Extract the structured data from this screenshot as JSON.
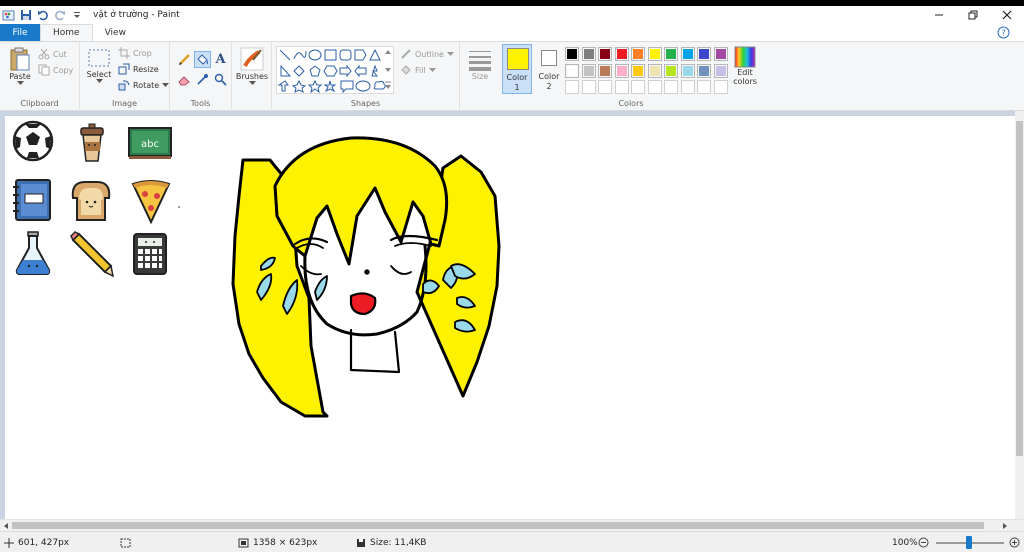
{
  "window": {
    "title": "vật ở trường - Paint"
  },
  "tabs": {
    "file": "File",
    "home": "Home",
    "view": "View"
  },
  "clipboard": {
    "paste": "Paste",
    "cut": "Cut",
    "copy": "Copy",
    "group": "Clipboard"
  },
  "image": {
    "select": "Select",
    "crop": "Crop",
    "resize": "Resize",
    "rotate": "Rotate",
    "group": "Image"
  },
  "tools": {
    "group": "Tools",
    "text_glyph": "A"
  },
  "brushes": {
    "label": "Brushes"
  },
  "shapes": {
    "outline": "Outline",
    "fill": "Fill",
    "group": "Shapes"
  },
  "size": {
    "label": "Size"
  },
  "colors": {
    "color1_label": "Color",
    "color1_num": "1",
    "color2_label": "Color",
    "color2_num": "2",
    "edit_label1": "Edit",
    "edit_label2": "colors",
    "group": "Colors",
    "color1_value": "#fff200",
    "color2_value": "#ffffff",
    "palette_row1": [
      "#000000",
      "#7f7f7f",
      "#880015",
      "#ed1c24",
      "#ff7f27",
      "#fff200",
      "#22b14c",
      "#00a2e8",
      "#3f48cc",
      "#a349a4"
    ],
    "palette_row2": [
      "#ffffff",
      "#c3c3c3",
      "#b97a57",
      "#ffaec9",
      "#ffc90e",
      "#efe4b0",
      "#b5e61d",
      "#99d9ea",
      "#7092be",
      "#c8bfe7"
    ]
  },
  "canvas_icons": [
    "soccer-ball",
    "coffee-cup",
    "chalkboard",
    "notebook",
    "toast",
    "pizza-slice",
    "flask",
    "pencil",
    "calculator"
  ],
  "chalkboard_text": "abc",
  "drawing": {
    "hair_color": "#fff200",
    "tear_color": "#99d9ea",
    "mouth_color": "#ed1c24"
  },
  "status": {
    "cursor_pos": "601, 427px",
    "dimensions": "1358 × 623px",
    "file_size": "Size: 11,4KB",
    "zoom": "100%"
  }
}
